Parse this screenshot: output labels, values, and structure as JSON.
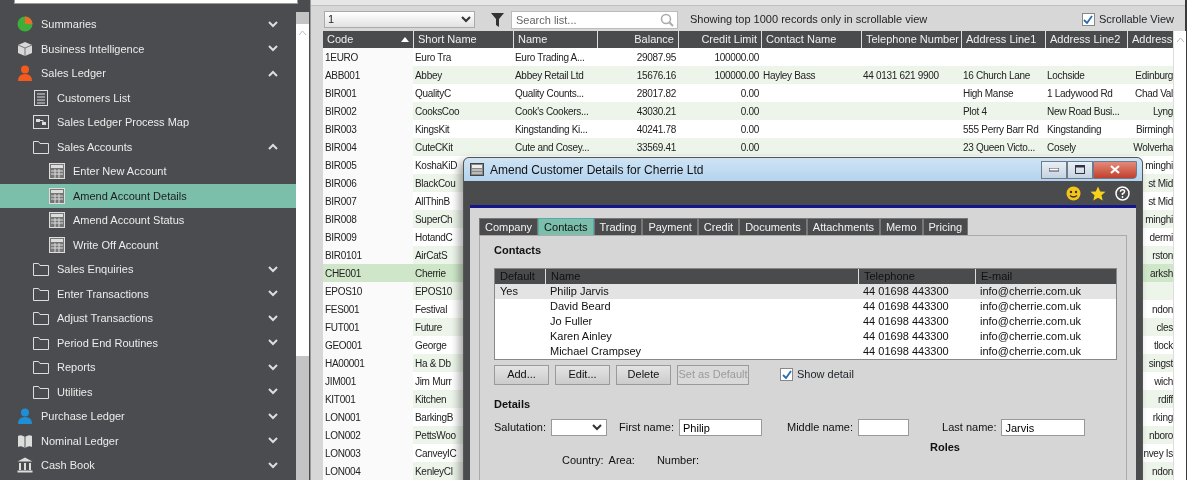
{
  "sidebar": {
    "items": [
      {
        "label": "Summaries",
        "kind": "pie",
        "expanded": false,
        "selected": false
      },
      {
        "label": "Business Intelligence",
        "kind": "cube",
        "expanded": false,
        "selected": false
      },
      {
        "label": "Sales Ledger",
        "kind": "person",
        "color": "#f25a1e",
        "expanded": true,
        "selected": false,
        "children": [
          {
            "label": "Customers List",
            "kind": "list",
            "selected": false
          },
          {
            "label": "Sales Ledger Process Map",
            "kind": "diagram",
            "selected": false
          },
          {
            "label": "Sales Accounts",
            "kind": "folder",
            "expanded": true,
            "selected": false,
            "children": [
              {
                "label": "Enter New Account",
                "kind": "form",
                "selected": false
              },
              {
                "label": "Amend Account Details",
                "kind": "form",
                "selected": true
              },
              {
                "label": "Amend Account Status",
                "kind": "form",
                "selected": false
              },
              {
                "label": "Write Off Account",
                "kind": "form",
                "selected": false
              }
            ]
          },
          {
            "label": "Sales Enquiries",
            "kind": "folder",
            "expanded": false,
            "selected": false
          },
          {
            "label": "Enter Transactions",
            "kind": "folder",
            "expanded": false,
            "selected": false
          },
          {
            "label": "Adjust Transactions",
            "kind": "folder",
            "expanded": false,
            "selected": false
          },
          {
            "label": "Period End Routines",
            "kind": "folder",
            "expanded": false,
            "selected": false
          },
          {
            "label": "Reports",
            "kind": "folder",
            "expanded": false,
            "selected": false
          },
          {
            "label": "Utilities",
            "kind": "folder",
            "expanded": false,
            "selected": false
          }
        ]
      },
      {
        "label": "Purchase Ledger",
        "kind": "person",
        "color": "#1e8fd6",
        "expanded": false,
        "selected": false
      },
      {
        "label": "Nominal Ledger",
        "kind": "book",
        "expanded": false,
        "selected": false
      },
      {
        "label": "Cash Book",
        "kind": "bank",
        "expanded": false,
        "selected": false
      }
    ]
  },
  "toolbar": {
    "page_select": "1",
    "search": {
      "placeholder": "Search list..."
    },
    "info": "Showing top 1000 records only in scrollable view",
    "scrollable_view": {
      "label": "Scrollable View",
      "checked": true
    }
  },
  "table": {
    "columns": [
      {
        "label": "Code",
        "sorted": true
      },
      {
        "label": "Short Name",
        "sorted": false
      },
      {
        "label": "Name",
        "sorted": false
      },
      {
        "label": "Balance",
        "sorted": false
      },
      {
        "label": "Credit Limit",
        "sorted": false
      },
      {
        "label": "Contact Name",
        "sorted": false
      },
      {
        "label": "Telephone Number",
        "sorted": false
      },
      {
        "label": "Address Line1",
        "sorted": false
      },
      {
        "label": "Address Line2",
        "sorted": false
      },
      {
        "label": "Address",
        "sorted": false
      }
    ],
    "rows": [
      {
        "selected": false,
        "cells": [
          "1EURO",
          "Euro Tra",
          "Euro Trading A...",
          "29087.95",
          "100000.00",
          null,
          null,
          null,
          null,
          null
        ]
      },
      {
        "selected": false,
        "cells": [
          "ABB001",
          "Abbey",
          "Abbey Retail Ltd",
          "15676.16",
          "100000.00",
          "Hayley Bass",
          "44 0131 621 9900",
          "16 Church Lane",
          "Lochside",
          "Edinburg"
        ]
      },
      {
        "selected": false,
        "cells": [
          "BIR001",
          "QualityC",
          "Quality Counts...",
          "28017.82",
          "0.00",
          null,
          null,
          "High Manse",
          "1 Ladywood Rd",
          "Chad Val"
        ]
      },
      {
        "selected": false,
        "cells": [
          "BIR002",
          "CooksCoo",
          "Cook's Cookers...",
          "43030.21",
          "0.00",
          null,
          null,
          "Plot 4",
          "New Road Busi...",
          "Lyng"
        ]
      },
      {
        "selected": false,
        "cells": [
          "BIR003",
          "KingsKit",
          "Kingstanding Ki...",
          "40241.78",
          "0.00",
          null,
          null,
          "555 Perry Barr Rd",
          "Kingstanding",
          "Birmingh"
        ]
      },
      {
        "selected": false,
        "cells": [
          "BIR004",
          "CuteCKit",
          "Cute and Cosey...",
          "33569.41",
          "0.00",
          null,
          null,
          "23 Queen Victo...",
          "Cosely",
          "Wolverha"
        ]
      },
      {
        "selected": false,
        "cells": [
          "BIR005",
          "KoshaKiD",
          null,
          null,
          null,
          null,
          null,
          null,
          null,
          "minghi"
        ]
      },
      {
        "selected": false,
        "cells": [
          "BIR006",
          "BlackCou",
          null,
          null,
          null,
          null,
          null,
          null,
          null,
          "st Mid"
        ]
      },
      {
        "selected": false,
        "cells": [
          "BIR007",
          "AllThinB",
          null,
          null,
          null,
          null,
          null,
          null,
          null,
          "st Mid"
        ]
      },
      {
        "selected": false,
        "cells": [
          "BIR008",
          "SuperCh",
          null,
          null,
          null,
          null,
          null,
          null,
          null,
          "minghi"
        ]
      },
      {
        "selected": false,
        "cells": [
          "BIR009",
          "HotandC",
          null,
          null,
          null,
          null,
          null,
          null,
          null,
          "dermi"
        ]
      },
      {
        "selected": false,
        "cells": [
          "BIR0101",
          "AirCatS",
          null,
          null,
          null,
          null,
          null,
          null,
          null,
          "rston"
        ]
      },
      {
        "selected": true,
        "cells": [
          "CHE001",
          "Cherrie",
          null,
          null,
          null,
          null,
          null,
          null,
          null,
          "arksh"
        ]
      },
      {
        "selected": false,
        "cells": [
          "EPOS10",
          "EPOS10",
          null,
          null,
          null,
          null,
          null,
          null,
          null,
          null
        ]
      },
      {
        "selected": false,
        "cells": [
          "FES001",
          "Festival",
          null,
          null,
          null,
          null,
          null,
          null,
          null,
          "ndon"
        ]
      },
      {
        "selected": false,
        "cells": [
          "FUT001",
          "Future",
          null,
          null,
          null,
          null,
          null,
          null,
          null,
          "cles"
        ]
      },
      {
        "selected": false,
        "cells": [
          "GEO001",
          "George",
          null,
          null,
          null,
          null,
          null,
          null,
          null,
          "tlock"
        ]
      },
      {
        "selected": false,
        "cells": [
          "HA00001",
          "Ha & Db",
          null,
          null,
          null,
          null,
          null,
          null,
          null,
          "singst"
        ]
      },
      {
        "selected": false,
        "cells": [
          "JIM001",
          "Jim Murr",
          null,
          null,
          null,
          null,
          null,
          null,
          null,
          "wich"
        ]
      },
      {
        "selected": false,
        "cells": [
          "KIT001",
          "Kitchen",
          null,
          null,
          null,
          null,
          null,
          null,
          null,
          "rdiff"
        ]
      },
      {
        "selected": false,
        "cells": [
          "LON001",
          "BarkingB",
          null,
          null,
          null,
          null,
          null,
          null,
          null,
          "rking"
        ]
      },
      {
        "selected": false,
        "cells": [
          "LON002",
          "PettsWoo",
          null,
          null,
          null,
          null,
          null,
          null,
          null,
          "nboro"
        ]
      },
      {
        "selected": false,
        "cells": [
          "LON003",
          "CanveyIC",
          null,
          null,
          null,
          null,
          null,
          null,
          null,
          "nvey Is"
        ]
      },
      {
        "selected": false,
        "cells": [
          "LON004",
          "KenleyCl",
          null,
          null,
          null,
          null,
          null,
          null,
          null,
          "ndon"
        ]
      }
    ]
  },
  "dialog": {
    "title": "Amend Customer Details for Cherrie Ltd",
    "tabs": [
      {
        "label": "Company",
        "selected": false
      },
      {
        "label": "Contacts",
        "selected": true
      },
      {
        "label": "Trading",
        "selected": false
      },
      {
        "label": "Payment",
        "selected": false
      },
      {
        "label": "Credit",
        "selected": false
      },
      {
        "label": "Documents",
        "selected": false
      },
      {
        "label": "Attachments",
        "selected": false
      },
      {
        "label": "Memo",
        "selected": false
      },
      {
        "label": "Pricing",
        "selected": false
      }
    ],
    "contacts": {
      "heading": "Contacts",
      "columns": [
        "Default",
        "Name",
        "Telephone",
        "E-mail"
      ],
      "rows": [
        {
          "default": "Yes",
          "name": "Philip Jarvis",
          "telephone": "44 01698 443300",
          "email": "info@cherrie.com.uk",
          "selected": true
        },
        {
          "name": "David Beard",
          "telephone": "44 01698 443300",
          "email": "info@cherrie.com.uk",
          "selected": false
        },
        {
          "name": "Jo Fuller",
          "telephone": "44 01698 443300",
          "email": "info@cherrie.com.uk",
          "selected": false
        },
        {
          "name": "Karen Ainley",
          "telephone": "44 01698 443300",
          "email": "info@cherrie.com.uk",
          "selected": false
        },
        {
          "name": "Michael Crampsey",
          "telephone": "44 01698 443300",
          "email": "info@cherrie.com.uk",
          "selected": false
        }
      ]
    },
    "buttons": [
      {
        "label": "Add...",
        "disabled": false
      },
      {
        "label": "Edit...",
        "disabled": false
      },
      {
        "label": "Delete",
        "disabled": false
      },
      {
        "label": "Set as Default",
        "disabled": true
      }
    ],
    "show_detail": {
      "label": "Show detail",
      "checked": true
    },
    "details": {
      "heading": "Details",
      "fields": [
        {
          "label": "Salutation:",
          "kind": "select"
        },
        {
          "label": "First name:",
          "kind": "text",
          "value": "Philip"
        },
        {
          "label": "Middle name:",
          "kind": "text"
        },
        {
          "label": "Last name:",
          "kind": "text",
          "value": "Jarvis"
        }
      ],
      "roles_heading": "Roles",
      "phone_labels": [
        "Country:",
        "Area:",
        "Number:"
      ]
    }
  }
}
